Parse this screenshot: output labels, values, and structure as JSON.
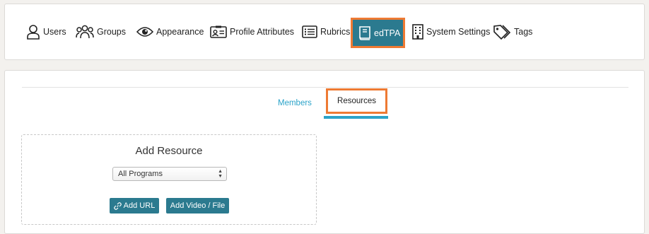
{
  "nav": {
    "users": "Users",
    "groups": "Groups",
    "appearance": "Appearance",
    "profile_attributes": "Profile Attributes",
    "rubrics": "Rubrics",
    "edtpa": "edTPA",
    "system_settings": "System Settings",
    "tags": "Tags"
  },
  "tabs": {
    "members": "Members",
    "resources": "Resources"
  },
  "add_resource": {
    "title": "Add Resource",
    "program_select_value": "All Programs",
    "add_url_label": "Add URL",
    "add_video_label": "Add Video / File"
  },
  "colors": {
    "accent_teal": "#2b7a8f",
    "highlight_orange": "#ee7a33",
    "tab_blue": "#2ba3c9"
  }
}
